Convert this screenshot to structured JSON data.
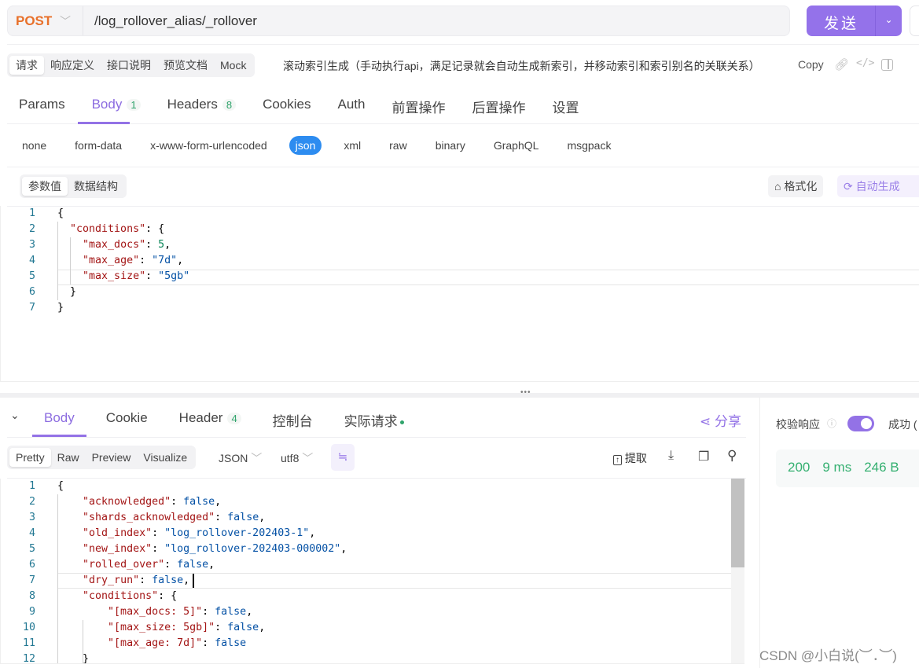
{
  "request": {
    "method": "POST",
    "url": "/log_rollover_alias/_rollover",
    "send_label": "发送",
    "mode_tabs": [
      "请求",
      "响应定义",
      "接口说明",
      "预览文档",
      "Mock"
    ],
    "description": "滚动索引生成（手动执行api，满足记录就会自动生成新索引，并移动索引和索引别名的关联关系）",
    "copy_label": "Copy",
    "tabs": [
      {
        "label": "Params"
      },
      {
        "label": "Body",
        "badge": "1"
      },
      {
        "label": "Headers",
        "badge": "8"
      },
      {
        "label": "Cookies"
      },
      {
        "label": "Auth"
      },
      {
        "label": "前置操作"
      },
      {
        "label": "后置操作"
      },
      {
        "label": "设置"
      }
    ],
    "active_tab": "Body",
    "body_types": [
      "none",
      "form-data",
      "x-www-form-urlencoded",
      "json",
      "xml",
      "raw",
      "binary",
      "GraphQL",
      "msgpack"
    ],
    "active_body_type": "json",
    "view_tabs": [
      "参数值",
      "数据结构"
    ],
    "format_label": "格式化",
    "autogen_label": "自动生成",
    "code": [
      [
        [
          "p",
          "{"
        ]
      ],
      [
        [
          "p",
          "  "
        ],
        [
          "k",
          "\"conditions\""
        ],
        [
          "p",
          ": {"
        ]
      ],
      [
        [
          "p",
          "    "
        ],
        [
          "k",
          "\"max_docs\""
        ],
        [
          "p",
          ": "
        ],
        [
          "n",
          "5"
        ],
        [
          "p",
          ","
        ]
      ],
      [
        [
          "p",
          "    "
        ],
        [
          "k",
          "\"max_age\""
        ],
        [
          "p",
          ": "
        ],
        [
          "s",
          "\"7d\""
        ],
        [
          "p",
          ","
        ]
      ],
      [
        [
          "p",
          "    "
        ],
        [
          "k",
          "\"max_size\""
        ],
        [
          "p",
          ": "
        ],
        [
          "s",
          "\"5gb\""
        ]
      ],
      [
        [
          "p",
          "  }"
        ]
      ],
      [
        [
          "p",
          "}"
        ]
      ]
    ]
  },
  "response": {
    "tabs": [
      {
        "label": "Body"
      },
      {
        "label": "Cookie"
      },
      {
        "label": "Header",
        "badge": "4"
      },
      {
        "label": "控制台"
      },
      {
        "label": "实际请求"
      }
    ],
    "share_label": "分享",
    "view_modes": [
      "Pretty",
      "Raw",
      "Preview",
      "Visualize"
    ],
    "format": "JSON",
    "encoding": "utf8",
    "extract_label": "提取",
    "code": [
      [
        [
          "p",
          "{"
        ]
      ],
      [
        [
          "p",
          "    "
        ],
        [
          "k",
          "\"acknowledged\""
        ],
        [
          "p",
          ": "
        ],
        [
          "b",
          "false"
        ],
        [
          "p",
          ","
        ]
      ],
      [
        [
          "p",
          "    "
        ],
        [
          "k",
          "\"shards_acknowledged\""
        ],
        [
          "p",
          ": "
        ],
        [
          "b",
          "false"
        ],
        [
          "p",
          ","
        ]
      ],
      [
        [
          "p",
          "    "
        ],
        [
          "k",
          "\"old_index\""
        ],
        [
          "p",
          ": "
        ],
        [
          "s",
          "\"log_rollover-202403-1\""
        ],
        [
          "p",
          ","
        ]
      ],
      [
        [
          "p",
          "    "
        ],
        [
          "k",
          "\"new_index\""
        ],
        [
          "p",
          ": "
        ],
        [
          "s",
          "\"log_rollover-202403-000002\""
        ],
        [
          "p",
          ","
        ]
      ],
      [
        [
          "p",
          "    "
        ],
        [
          "k",
          "\"rolled_over\""
        ],
        [
          "p",
          ": "
        ],
        [
          "b",
          "false"
        ],
        [
          "p",
          ","
        ]
      ],
      [
        [
          "p",
          "    "
        ],
        [
          "k",
          "\"dry_run\""
        ],
        [
          "p",
          ": "
        ],
        [
          "b",
          "false"
        ],
        [
          "p",
          ","
        ]
      ],
      [
        [
          "p",
          "    "
        ],
        [
          "k",
          "\"conditions\""
        ],
        [
          "p",
          ": {"
        ]
      ],
      [
        [
          "p",
          "        "
        ],
        [
          "k",
          "\"[max_docs: 5]\""
        ],
        [
          "p",
          ": "
        ],
        [
          "b",
          "false"
        ],
        [
          "p",
          ","
        ]
      ],
      [
        [
          "p",
          "        "
        ],
        [
          "k",
          "\"[max_size: 5gb]\""
        ],
        [
          "p",
          ": "
        ],
        [
          "b",
          "false"
        ],
        [
          "p",
          ","
        ]
      ],
      [
        [
          "p",
          "        "
        ],
        [
          "k",
          "\"[max_age: 7d]\""
        ],
        [
          "p",
          ": "
        ],
        [
          "b",
          "false"
        ]
      ],
      [
        [
          "p",
          "    }"
        ]
      ]
    ],
    "validate_label": "校验响应",
    "validate_enabled": true,
    "result_label": "成功 (",
    "status_code": "200",
    "time": "9 ms",
    "size": "246 B"
  },
  "watermark": "CSDN @小白说(︶．︶)",
  "colors": {
    "accent": "#9372e6",
    "method": "#e8702a",
    "json_pill": "#2d8cf0",
    "success": "#35b071"
  }
}
